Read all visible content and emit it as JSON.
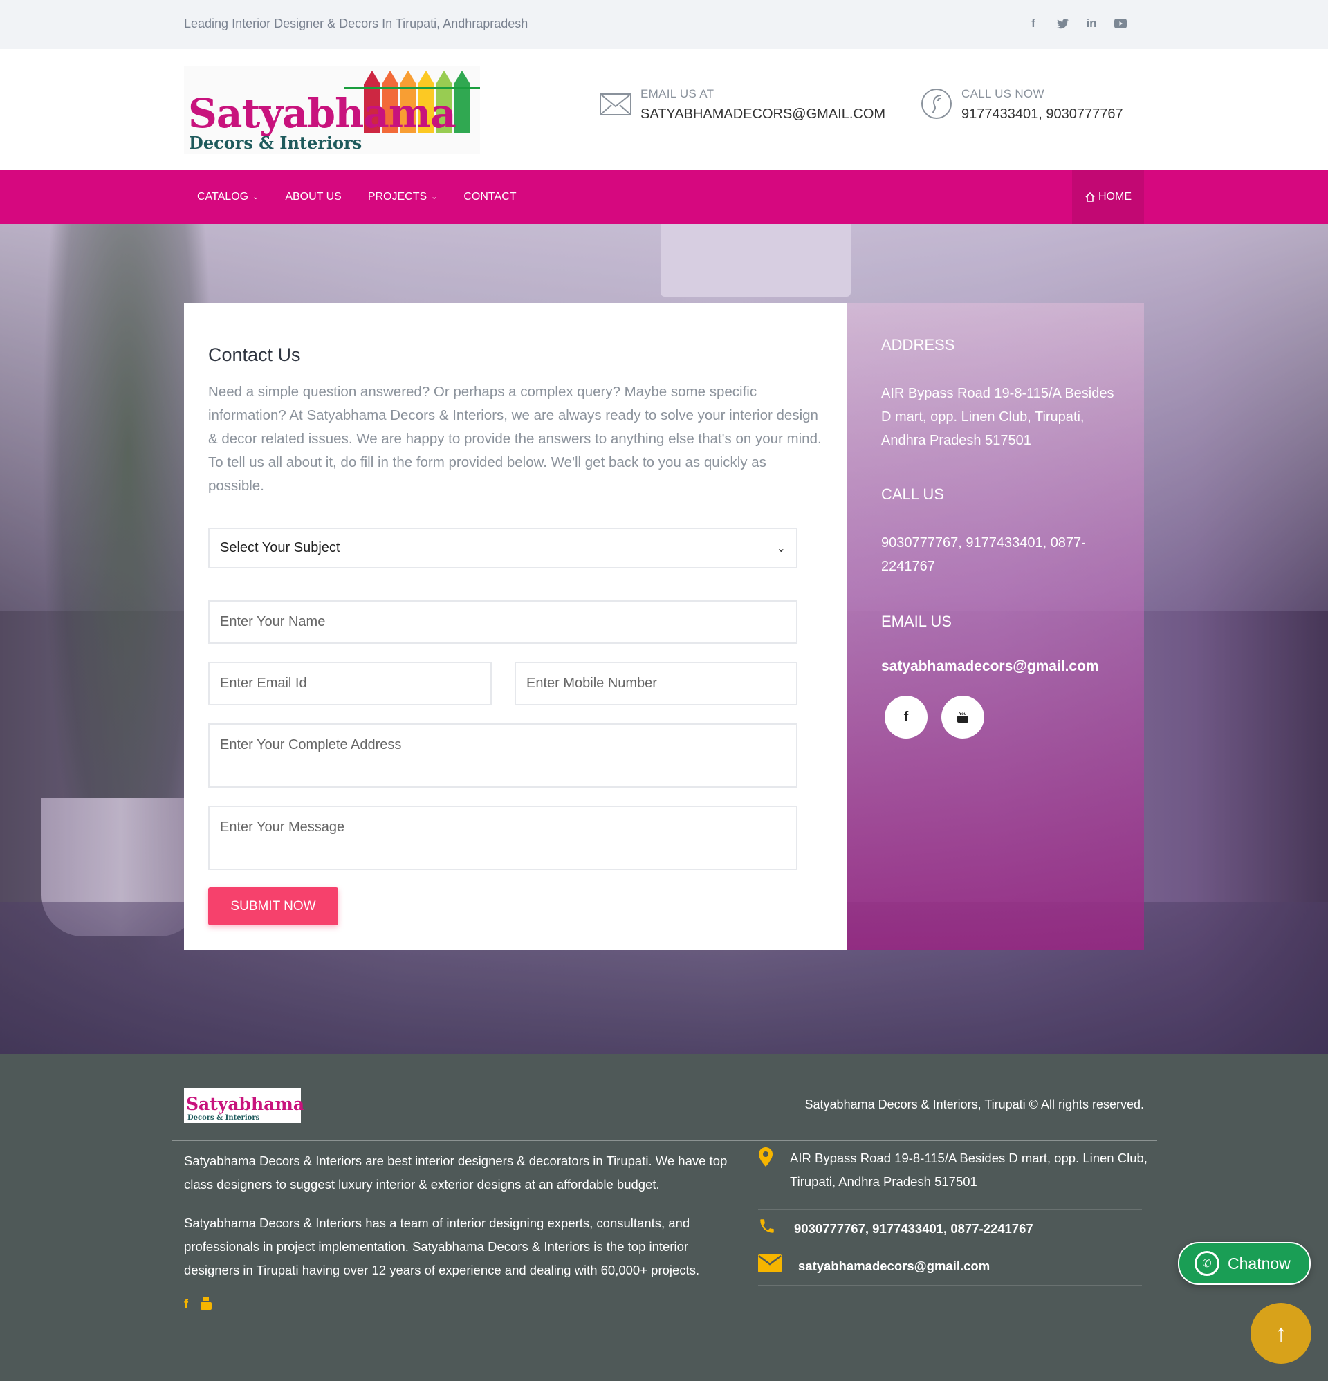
{
  "topbar": {
    "tagline": "Leading Interior Designer & Decors In Tirupati, Andhrapradesh",
    "socials": [
      "facebook-icon",
      "twitter-icon",
      "linkedin-icon",
      "youtube-icon"
    ]
  },
  "logo": {
    "brand": "Satyabhama",
    "subbrand": "Decors & Interiors"
  },
  "header": {
    "email_label": "EMAIL US AT",
    "email_value": "SATYABHAMADECORS@GMAIL.COM",
    "call_label": "CALL US NOW",
    "call_value": "9177433401, 9030777767"
  },
  "nav": {
    "items": [
      "CATALOG",
      "ABOUT US",
      "PROJECTS",
      "CONTACT"
    ],
    "home": "HOME"
  },
  "contact": {
    "title": "Contact Us",
    "intro": "Need a simple question answered? Or perhaps a complex query? Maybe some specific information? At Satyabhama Decors & Interiors, we are always ready to solve your interior design & decor related issues. We are happy to provide the answers to anything else that's on your mind. To tell us all about it, do fill in the form provided below. We'll get back to you as quickly as possible.",
    "subject_selected": "Select Your Subject",
    "name_placeholder": "Enter Your Name",
    "email_placeholder": "Enter Email Id",
    "mobile_placeholder": "Enter Mobile Number",
    "address_placeholder": "Enter Your Complete Address",
    "message_placeholder": "Enter Your Message",
    "submit": "SUBMIT NOW"
  },
  "info": {
    "address_heading": "ADDRESS",
    "address": "AIR Bypass Road 19-8-115/A Besides D mart, opp. Linen Club, Tirupati, Andhra Pradesh 517501",
    "call_heading": "CALL US",
    "phones": "9030777767, 9177433401, 0877-2241767",
    "email_heading": "EMAIL US",
    "email": "satyabhamadecors@gmail.com",
    "socials": [
      "facebook-icon",
      "youtube-icon"
    ]
  },
  "footer": {
    "brand": "Satyabhama",
    "subbrand": "Decors & Interiors",
    "copyright": "Satyabhama Decors & Interiors, Tirupati © All rights reserved.",
    "para1": "Satyabhama Decors & Interiors are best interior designers & decorators in Tirupati. We have top class designers to suggest luxury interior & exterior designs at an affordable budget.",
    "para2": "Satyabhama Decors & Interiors has a team of interior designing experts, consultants, and professionals in project implementation. Satyabhama Decors & Interiors is the top interior designers in Tirupati having over 12 years of experience and dealing with 60,000+ projects.",
    "address": "AIR Bypass Road 19-8-115/A Besides D mart, opp. Linen Club, Tirupati, Andhra Pradesh 517501",
    "phones": "9030777767, 9177433401, 0877-2241767",
    "email": "satyabhamadecors@gmail.com",
    "socials": [
      "facebook-icon",
      "youtube-icon"
    ]
  },
  "widgets": {
    "chat": "Chatnow"
  },
  "colors": {
    "nav": "#d6087f",
    "submit": "#f6416c",
    "footer": "#4f5958",
    "accent_yellow": "#f6b500",
    "whatsapp": "#1a9e55"
  }
}
